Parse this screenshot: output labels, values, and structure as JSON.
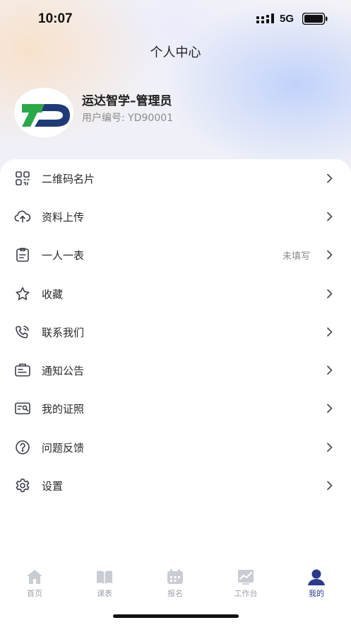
{
  "status_bar": {
    "time": "10:07",
    "network": "5G"
  },
  "header": {
    "title": "个人中心"
  },
  "profile": {
    "name": "运达智学–管理员",
    "user_id": "用户编号: YD90001"
  },
  "menu": {
    "items": [
      {
        "label": "二维码名片",
        "icon": "qrcode-icon",
        "status": ""
      },
      {
        "label": "资料上传",
        "icon": "cloud-upload-icon",
        "status": ""
      },
      {
        "label": "一人一表",
        "icon": "clipboard-icon",
        "status": "未填写"
      },
      {
        "label": "收藏",
        "icon": "star-icon",
        "status": ""
      },
      {
        "label": "联系我们",
        "icon": "phone-icon",
        "status": ""
      },
      {
        "label": "通知公告",
        "icon": "notice-icon",
        "status": ""
      },
      {
        "label": "我的证照",
        "icon": "id-card-icon",
        "status": ""
      },
      {
        "label": "问题反馈",
        "icon": "question-icon",
        "status": ""
      },
      {
        "label": "设置",
        "icon": "gear-icon",
        "status": ""
      }
    ]
  },
  "tabbar": {
    "tabs": [
      {
        "label": "首页",
        "icon": "home-icon"
      },
      {
        "label": "课表",
        "icon": "book-icon"
      },
      {
        "label": "报名",
        "icon": "calendar-icon"
      },
      {
        "label": "工作台",
        "icon": "chart-icon"
      },
      {
        "label": "我的",
        "icon": "user-icon"
      }
    ],
    "active_index": 4
  },
  "colors": {
    "accent": "#2c3a8c",
    "inactive_tab": "#c9ccd3",
    "logo_green": "#2aa84a",
    "logo_navy": "#1f3a78"
  }
}
